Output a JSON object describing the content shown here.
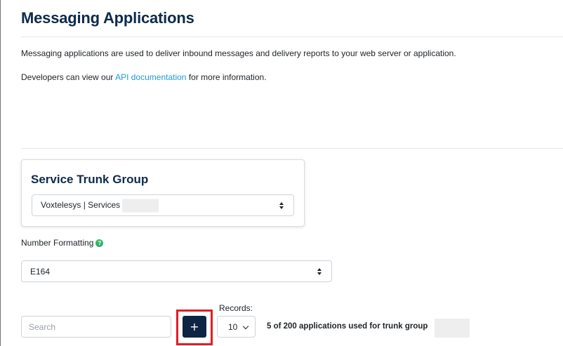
{
  "page": {
    "title": "Messaging Applications",
    "description": "Messaging applications are used to deliver inbound messages and delivery reports to your web server or application.",
    "developers_prefix": "Developers can view our ",
    "api_link_text": "API documentation",
    "developers_suffix": " for more information."
  },
  "trunk_group": {
    "title": "Service Trunk Group",
    "selected": "Voxtelesys | Services"
  },
  "number_formatting": {
    "label": "Number Formatting",
    "help_glyph": "?",
    "selected": "E164"
  },
  "toolbar": {
    "search_placeholder": "Search",
    "add_label": "+",
    "records_label": "Records:",
    "records_value": "10",
    "usage_text": "5 of 200 applications used for trunk group"
  },
  "icons": {
    "help": "question-circle-icon",
    "add": "plus-icon",
    "select_arrows": "up-down-caret-icon",
    "records_chevron": "chevron-down-icon"
  },
  "colors": {
    "title": "#0d2a4a",
    "link": "#1f9bd7",
    "primary_button": "#0d2444",
    "help_icon": "#34b36a",
    "highlight": "#e31e24"
  }
}
